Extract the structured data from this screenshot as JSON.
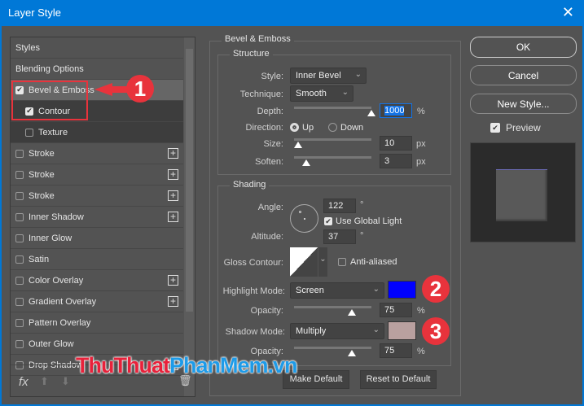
{
  "window": {
    "title": "Layer Style",
    "close_icon": "close-icon"
  },
  "sidebar": {
    "items": [
      {
        "label": "Styles",
        "checkbox": false,
        "checked": false,
        "plus": false
      },
      {
        "label": "Blending Options",
        "checkbox": false,
        "checked": false,
        "plus": false
      },
      {
        "label": "Bevel & Emboss",
        "checkbox": true,
        "checked": true,
        "plus": false
      },
      {
        "label": "Contour",
        "checkbox": true,
        "checked": true,
        "plus": false
      },
      {
        "label": "Texture",
        "checkbox": true,
        "checked": false,
        "plus": false
      },
      {
        "label": "Stroke",
        "checkbox": true,
        "checked": false,
        "plus": true
      },
      {
        "label": "Stroke",
        "checkbox": true,
        "checked": false,
        "plus": true
      },
      {
        "label": "Stroke",
        "checkbox": true,
        "checked": false,
        "plus": true
      },
      {
        "label": "Inner Shadow",
        "checkbox": true,
        "checked": false,
        "plus": true
      },
      {
        "label": "Inner Glow",
        "checkbox": true,
        "checked": false,
        "plus": false
      },
      {
        "label": "Satin",
        "checkbox": true,
        "checked": false,
        "plus": false
      },
      {
        "label": "Color Overlay",
        "checkbox": true,
        "checked": false,
        "plus": true
      },
      {
        "label": "Gradient Overlay",
        "checkbox": true,
        "checked": false,
        "plus": true
      },
      {
        "label": "Pattern Overlay",
        "checkbox": true,
        "checked": false,
        "plus": false
      },
      {
        "label": "Outer Glow",
        "checkbox": true,
        "checked": false,
        "plus": false
      },
      {
        "label": "Drop Shadow",
        "checkbox": true,
        "checked": false,
        "plus": true
      }
    ],
    "fx_label": "fx"
  },
  "bevel": {
    "title": "Bevel & Emboss",
    "structure": {
      "title": "Structure",
      "style_label": "Style:",
      "style_value": "Inner Bevel",
      "technique_label": "Technique:",
      "technique_value": "Smooth",
      "depth_label": "Depth:",
      "depth_value": "1000",
      "depth_unit": "%",
      "depth_slider": 1.0,
      "direction_label": "Direction:",
      "direction_up": "Up",
      "direction_down": "Down",
      "direction_selected": "Up",
      "size_label": "Size:",
      "size_value": "10",
      "size_unit": "px",
      "size_slider": 0.05,
      "soften_label": "Soften:",
      "soften_value": "3",
      "soften_unit": "px",
      "soften_slider": 0.16
    },
    "shading": {
      "title": "Shading",
      "angle_label": "Angle:",
      "angle_value": "122",
      "angle_unit": "°",
      "global_light_label": "Use Global Light",
      "global_light_checked": true,
      "altitude_label": "Altitude:",
      "altitude_value": "37",
      "altitude_unit": "°",
      "gloss_label": "Gloss Contour:",
      "anti_aliased_label": "Anti-aliased",
      "highlight_label": "Highlight Mode:",
      "highlight_value": "Screen",
      "highlight_color": "#0000ff",
      "hopacity_label": "Opacity:",
      "hopacity_value": "75",
      "hopacity_unit": "%",
      "hopacity_slider": 0.75,
      "shadow_label": "Shadow Mode:",
      "shadow_value": "Multiply",
      "shadow_color": "#b9a09f",
      "sopacity_label": "Opacity:",
      "sopacity_value": "75",
      "sopacity_unit": "%",
      "sopacity_slider": 0.75
    },
    "make_default": "Make Default",
    "reset_default": "Reset to Default"
  },
  "actions": {
    "ok": "OK",
    "cancel": "Cancel",
    "new_style": "New Style...",
    "preview": "Preview",
    "preview_checked": true
  },
  "annotations": {
    "badge1": "1",
    "badge2": "2",
    "badge3": "3"
  },
  "watermark": {
    "part1": "ThuThuat",
    "part2": "PhanMem.vn"
  }
}
